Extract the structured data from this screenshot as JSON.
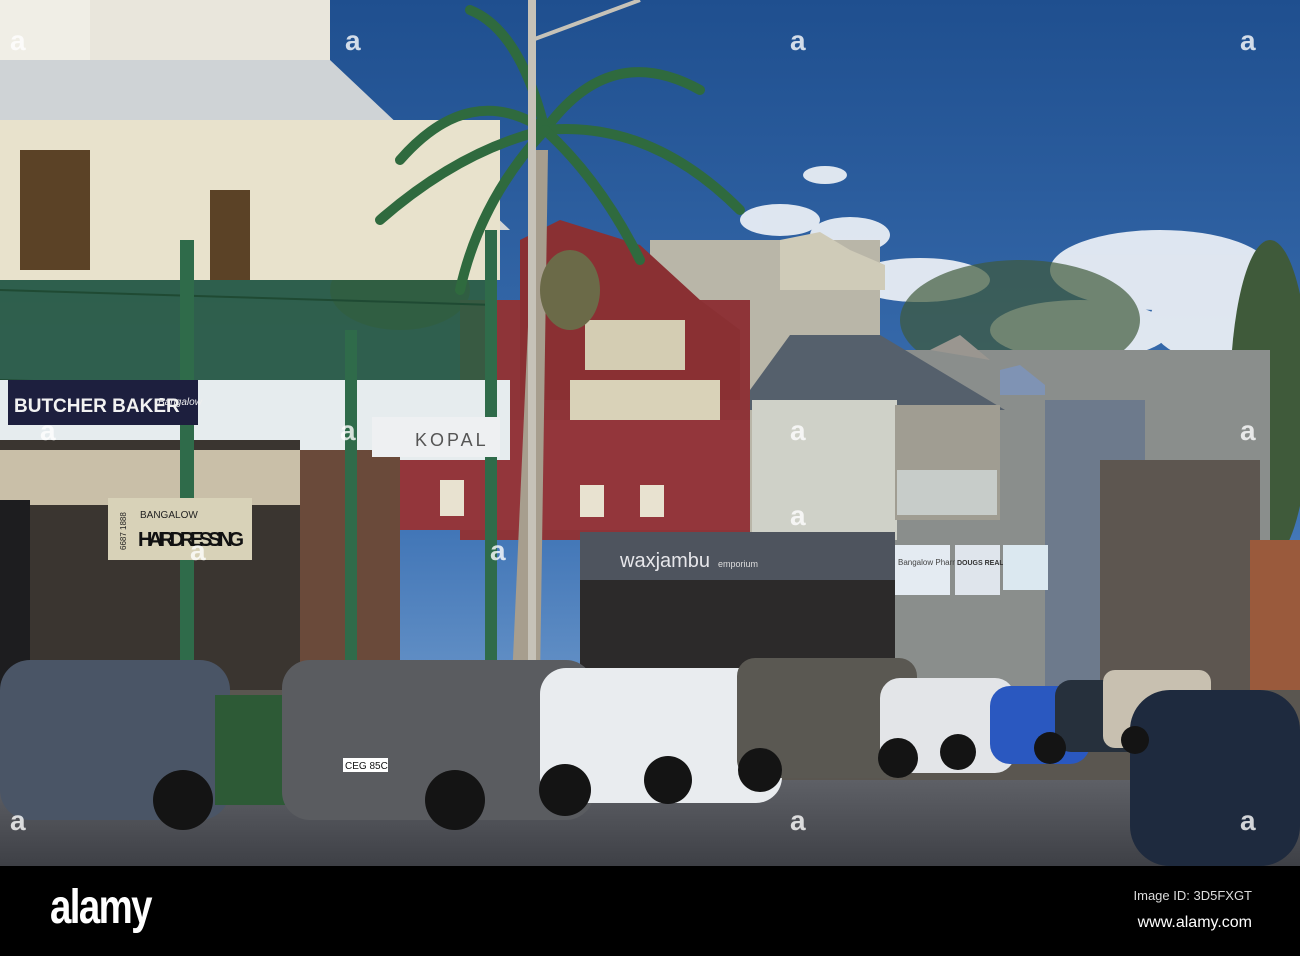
{
  "signs": {
    "butcher_baker": "BUTCHER BAKER",
    "butcher_baker_script": "Bangalow",
    "kopal": "KOPAL",
    "hairdressing_top": "BANGALOW",
    "hairdressing_main": "HAIRDRESSING",
    "hairdressing_phone": "6687 1888",
    "waxjambu": "waxjambu",
    "emporium": "emporium",
    "pharmacy": "Bangalow Pharmacy",
    "real_estate": "DOUGS REAL ESTATE"
  },
  "watermark": {
    "logo": "alamy",
    "image_id": "Image ID: 3D5FXGT",
    "url": "www.alamy.com"
  },
  "plates": {
    "grey_suv": "CEG 85C"
  }
}
